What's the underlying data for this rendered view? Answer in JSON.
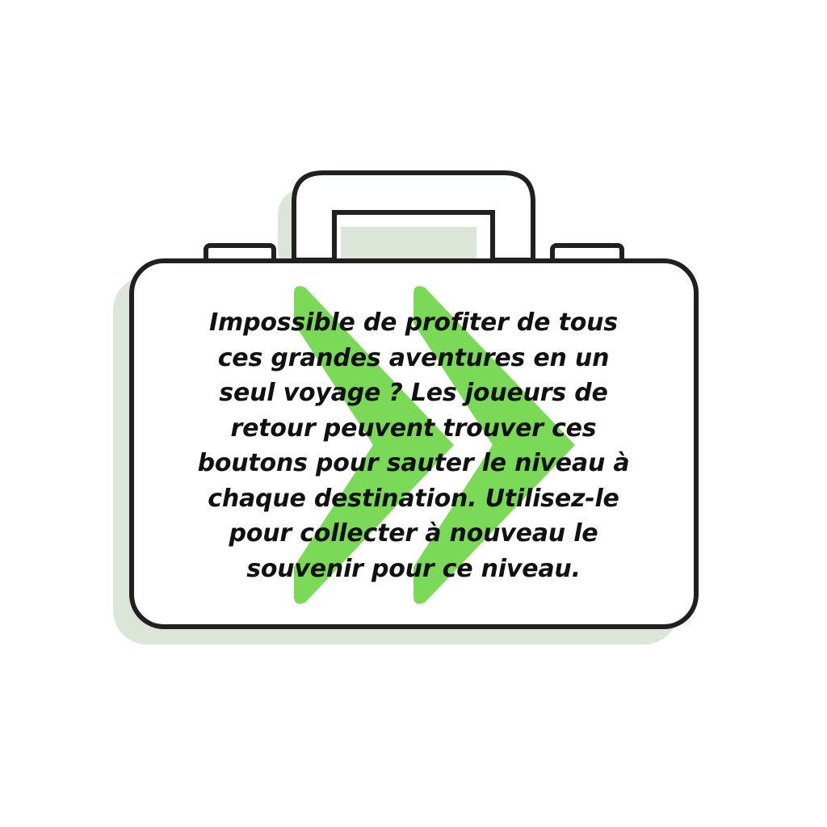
{
  "tip": {
    "text": "Impossible de profiter de tous\nces grandes aventures en un\nseul voyage ? Les joueurs de\nretour peuvent trouver ces\nboutons pour sauter le niveau à\nchaque destination. Utilisez-le\npour collecter à nouveau le\nsouvenir pour ce niveau."
  },
  "colors": {
    "outline": "#231f20",
    "shadow": "#dce6d8",
    "arrow": "#7ad957",
    "background": "#ffffff"
  },
  "icons": {
    "case": "suitcase-icon",
    "skip": "skip-level-icon"
  }
}
